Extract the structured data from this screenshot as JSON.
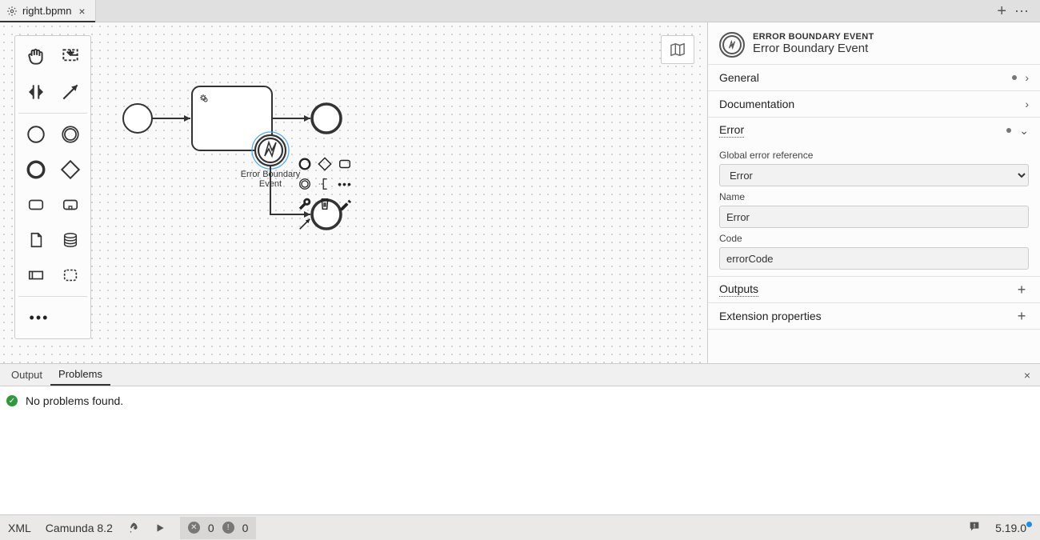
{
  "tab": {
    "filename": "right.bpmn"
  },
  "palette": {
    "tools": [
      "hand",
      "lasso",
      "space",
      "connect"
    ],
    "shapes": [
      "start-event",
      "end-event",
      "intermediate-event",
      "gateway",
      "task",
      "subprocess",
      "data-object",
      "data-store",
      "pool",
      "group"
    ]
  },
  "diagram": {
    "boundary_label": "Error Boundary Event"
  },
  "props": {
    "header_caps": "ERROR BOUNDARY EVENT",
    "header_title": "Error Boundary Event",
    "sections": {
      "general": {
        "label": "General"
      },
      "documentation": {
        "label": "Documentation"
      },
      "error": {
        "label": "Error",
        "global_ref_label": "Global error reference",
        "global_ref_value": "Error",
        "name_label": "Name",
        "name_value": "Error",
        "code_label": "Code",
        "code_value": "errorCode"
      },
      "outputs": {
        "label": "Outputs"
      },
      "extension": {
        "label": "Extension properties"
      }
    }
  },
  "bottom_tabs": {
    "output": "Output",
    "problems": "Problems",
    "message": "No problems found."
  },
  "statusbar": {
    "xml": "XML",
    "engine": "Camunda 8.2",
    "err_count": "0",
    "warn_count": "0",
    "version": "5.19.0"
  }
}
